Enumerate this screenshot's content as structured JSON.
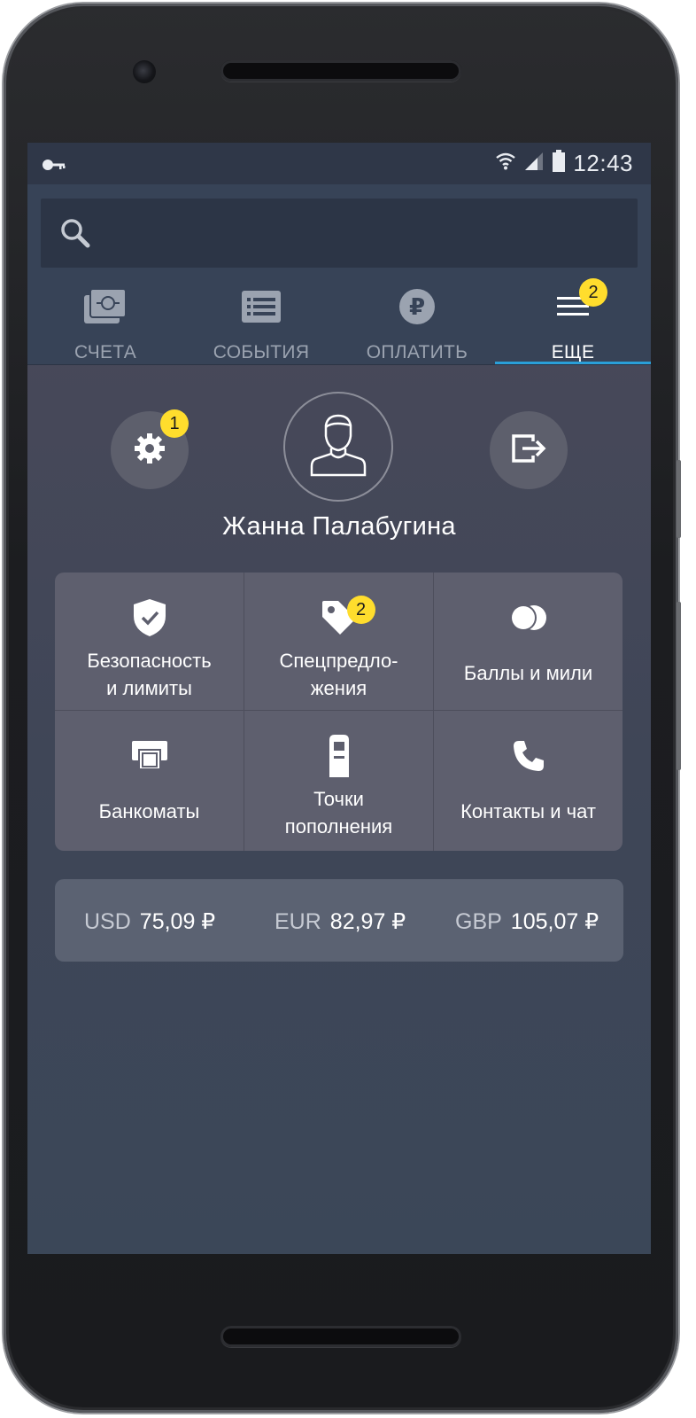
{
  "status_bar": {
    "time": "12:43"
  },
  "search": {
    "placeholder": ""
  },
  "tabs": [
    {
      "label": "СЧЕТА",
      "icon": "accounts-icon"
    },
    {
      "label": "СОБЫТИЯ",
      "icon": "events-list-icon"
    },
    {
      "label": "ОПЛАТИТЬ",
      "icon": "ruble-icon"
    },
    {
      "label": "ЕЩЕ",
      "icon": "menu-icon",
      "badge": "2",
      "active": true
    }
  ],
  "profile": {
    "settings_badge": "1",
    "name": "Жанна Палабугина"
  },
  "menu": {
    "security": {
      "line1": "Безопасность",
      "line2": "и лимиты"
    },
    "offers": {
      "line1": "Спецпредло-",
      "line2": "жения",
      "badge": "2"
    },
    "points": {
      "label": "Баллы и мили"
    },
    "atms": {
      "label": "Банкоматы"
    },
    "topup": {
      "line1": "Точки",
      "line2": "пополнения"
    },
    "contacts": {
      "label": "Контакты и чат"
    }
  },
  "rates": [
    {
      "currency": "USD",
      "value": "75,09 ₽"
    },
    {
      "currency": "EUR",
      "value": "82,97 ₽"
    },
    {
      "currency": "GBP",
      "value": "105,07 ₽"
    }
  ],
  "colors": {
    "badge": "#ffdd2d",
    "active_tab_indicator": "#2a9fd8",
    "topbar": "#374357"
  }
}
